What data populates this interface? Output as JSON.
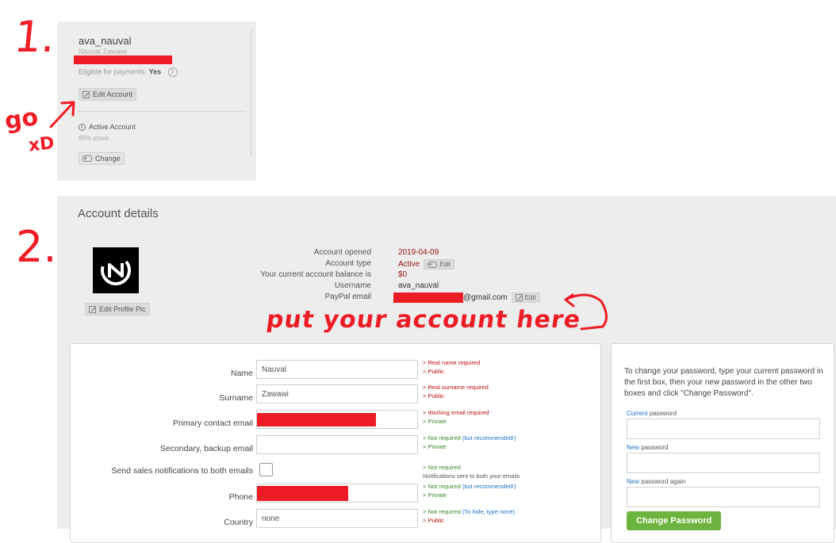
{
  "annotations": {
    "step1": "1.",
    "go": "go",
    "xd": "xD",
    "step2": "2.",
    "put_account": "put your account here"
  },
  "account_card": {
    "username": "ava_nauval",
    "full_name": "Nauval Zawawi",
    "eligible_label": "Eligible for payments:",
    "eligible_value": "Yes",
    "edit_account_label": "Edit Account",
    "active_label": "Active Account",
    "share_text": "85% share.",
    "change_label": "Change"
  },
  "account_details": {
    "title": "Account details",
    "edit_profile_pic_label": "Edit Profile Pic",
    "info": [
      {
        "label": "Account opened",
        "value": "2019-04-09"
      },
      {
        "label": "Account type",
        "value": "Active",
        "button": "Edit"
      },
      {
        "label": "Your current account balance is",
        "value": "$0"
      },
      {
        "label": "Username",
        "value": "ava_nauval"
      },
      {
        "label": "PayPal email",
        "value": "@gmail.com",
        "button": "Edit"
      }
    ]
  },
  "form": {
    "fields": [
      {
        "label": "Name",
        "value": "Nauval",
        "note1": "> Real name required",
        "note2": "> Public"
      },
      {
        "label": "Surname",
        "value": "Zawawi",
        "note1": "> Real surname required",
        "note2": "> Public"
      },
      {
        "label": "Primary contact email",
        "value": "",
        "note1": "> Working email required",
        "note2": "> Private"
      },
      {
        "label": "Secondary, backup email",
        "value": "",
        "note1": "> Not required",
        "note1b": "(but recommended!)",
        "note2": "> Private"
      },
      {
        "label": "Send sales notifications to both emails",
        "note1": "> Not required",
        "note2": "Notifications sent to both your emails"
      },
      {
        "label": "Phone",
        "value": "",
        "note1": "> Not required",
        "note1b": "(but recommended!)",
        "note2": "> Private"
      },
      {
        "label": "Country",
        "value": "none",
        "note1": "> Not required",
        "note1b": "(To hide, type none)",
        "note2": "> Public"
      }
    ]
  },
  "password": {
    "description": "To change your password, type your current password in the first box, then your new password in the other two boxes and click \"Change Password\".",
    "current_a": "Current",
    "current_b": " password",
    "new_a": "New",
    "new_b": " password",
    "again_a": "New",
    "again_b": " password again",
    "button_label": "Change Password"
  },
  "colors": {
    "accent_green": "#6db33f",
    "annotation_red": "#ee1c25",
    "value_red": "#9a1010"
  }
}
